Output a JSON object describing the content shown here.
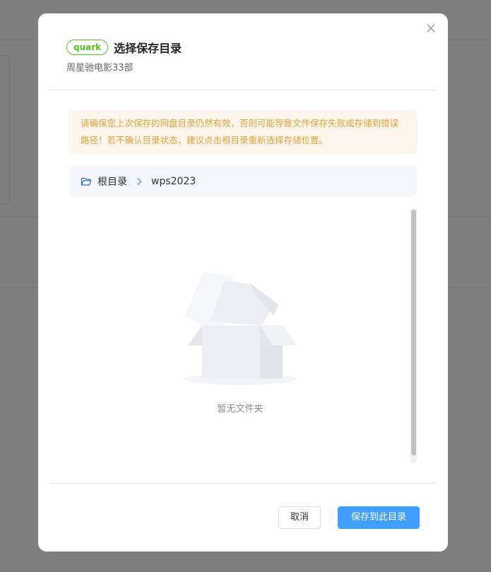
{
  "dialog": {
    "badge": "quark",
    "title": "选择保存目录",
    "subtitle": "周星驰电影33部",
    "warning": "请确保您上次保存的网盘目录仍然有效，否则可能导致文件保存失败或存储到错误路径！若不确认目录状态，建议点击根目录重新选择存储位置。",
    "breadcrumb": [
      "根目录",
      "wps2023"
    ],
    "empty_text": "暂无文件夹",
    "cancel_label": "取消",
    "confirm_label": "保存到此目录"
  },
  "icons": {
    "close": "close-icon",
    "folder": "folder-open-icon",
    "separator": "chevron-right-icon"
  },
  "colors": {
    "badge": "#52c41a",
    "warning_text": "#e6a23c",
    "warning_bg": "#fef6ec",
    "primary": "#409eff",
    "overlay": "#7f7f80"
  }
}
